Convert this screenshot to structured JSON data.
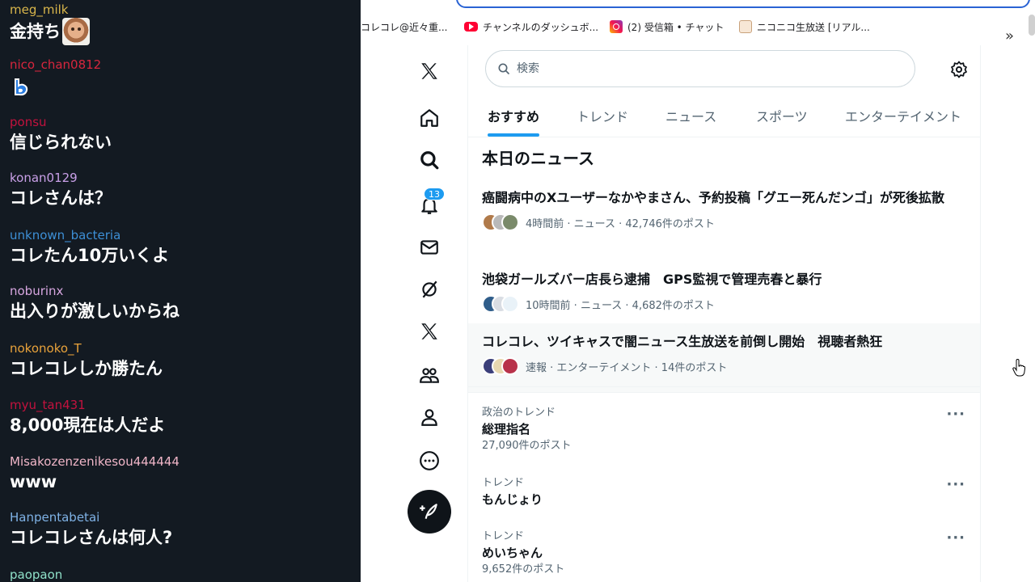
{
  "chat": {
    "messages": [
      {
        "user": "meg_milk",
        "color": "#d9b64b",
        "text": "金持ち",
        "emote": "face"
      },
      {
        "user": "nico_chan0812",
        "color": "#d7263d",
        "text": "",
        "emote": "b"
      },
      {
        "user": "ponsu",
        "color": "#c3123e",
        "text": "信じられない"
      },
      {
        "user": "konan0129",
        "color": "#c9a0e8",
        "text": "コレさんは？"
      },
      {
        "user": "unknown_bacteria",
        "color": "#3d8fd6",
        "text": "コレたん10万いくよ"
      },
      {
        "user": "noburinx",
        "color": "#d7a6e0",
        "text": "出入りが激しいからね"
      },
      {
        "user": "nokonoko_T",
        "color": "#e8a23b",
        "text": "コレコレしか勝たん"
      },
      {
        "user": "myu_tan431",
        "color": "#c3123e",
        "text": "8,000現在は人だよ"
      },
      {
        "user": "Misakozenzenikesou444444",
        "color": "#f0b6c8",
        "text": "www"
      },
      {
        "user": "Hanpentabetai",
        "color": "#7fb2e6",
        "text": "コレコレさんは何人?"
      },
      {
        "user": "paopaon",
        "color": "#8fe0c8",
        "text": ""
      }
    ]
  },
  "bookmarks": [
    {
      "label": "コレコレ@近々重...",
      "icon": "none"
    },
    {
      "label": "チャンネルのダッシュボ...",
      "icon": "youtube-icon"
    },
    {
      "label": "(2) 受信箱 • チャット",
      "icon": "instagram-icon"
    },
    {
      "label": "ニコニコ生放送 [リアル...",
      "icon": "niconico-icon"
    }
  ],
  "bookmarks_more": "»",
  "nav": {
    "badge": "13",
    "items": [
      "x-logo-icon",
      "home-icon",
      "explore-icon",
      "notifications-icon",
      "messages-icon",
      "grok-icon",
      "premium-icon",
      "communities-icon",
      "profile-icon",
      "more-icon"
    ]
  },
  "search": {
    "placeholder": "検索"
  },
  "tabs": [
    "おすすめ",
    "トレンド",
    "ニュース",
    "スポーツ",
    "エンターテイメント"
  ],
  "news": {
    "title": "本日のニュース",
    "items": [
      {
        "headline": "癌闘病中のXユーザーなかやまさん、予約投稿「グエー死んだンゴ」が死後拡散",
        "meta": "4時間前 · ニュース · 42,746件のポスト"
      },
      {
        "headline": "池袋ガールズバー店長ら逮捕　GPS監視で管理売春と暴行",
        "meta": "10時間前 · ニュース · 4,682件のポスト"
      },
      {
        "headline": "コレコレ、ツイキャスで闇ニュース生放送を前倒し開始　視聴者熱狂",
        "meta": "速報 · エンターテイメント · 14件のポスト"
      }
    ]
  },
  "trends": [
    {
      "category": "政治のトレンド",
      "name": "総理指名",
      "count": "27,090件のポスト"
    },
    {
      "category": "トレンド",
      "name": "もんじょり",
      "count": ""
    },
    {
      "category": "トレンド",
      "name": "めいちゃん",
      "count": "9,652件のポスト"
    }
  ],
  "trend_more": "···",
  "colors": {
    "accent": "#1d9bf0",
    "chat_bg": "#131a22"
  }
}
